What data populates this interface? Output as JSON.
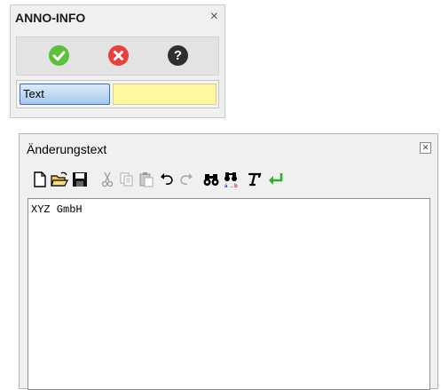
{
  "anno_info": {
    "title": "ANNO-INFO",
    "close_glyph": "×",
    "buttons": [
      {
        "name": "confirm",
        "icon": "check-circle-icon",
        "color": "#5dbf3b"
      },
      {
        "name": "cancel",
        "icon": "x-circle-icon",
        "color": "#e8403a"
      },
      {
        "name": "help",
        "icon": "question-circle-icon",
        "color": "#2f2f2f",
        "glyph": "?"
      }
    ],
    "text_button_label": "Text",
    "yellow_field_color": "#fff7a0"
  },
  "editor_window": {
    "title": "Änderungstext",
    "close_glyph": "⊠",
    "toolbar": [
      "new-document-icon",
      "open-folder-icon",
      "save-icon",
      "cut-icon",
      "copy-icon",
      "paste-icon",
      "undo-icon",
      "redo-icon",
      "find-icon",
      "replace-icon",
      "font-icon",
      "insert-return-icon"
    ],
    "content": "XYZ GmbH"
  }
}
